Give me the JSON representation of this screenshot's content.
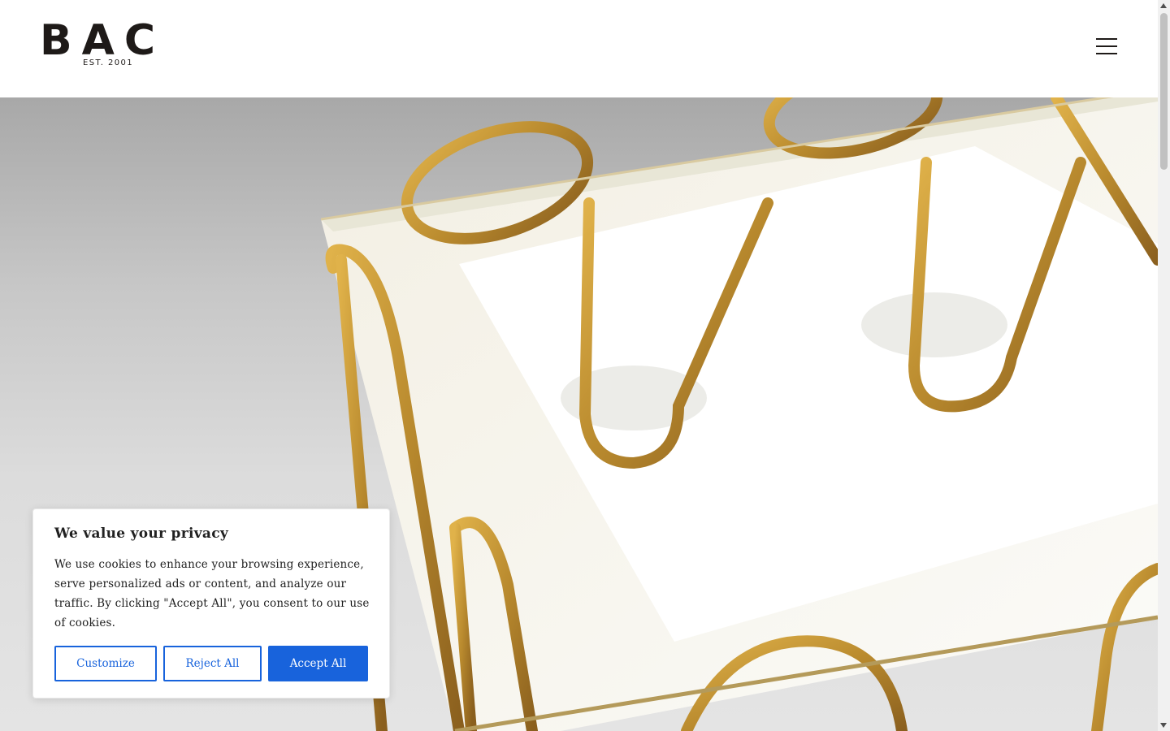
{
  "header": {
    "logo_text": "BAC",
    "logo_subtitle": "EST. 2001",
    "menu_icon": "hamburger-icon"
  },
  "hero": {
    "image_subject": "gilt metal side table with glass top"
  },
  "cookie_banner": {
    "title": "We value your privacy",
    "text": "We use cookies to enhance your browsing experience, serve personalized ads or content, and analyze our traffic. By clicking \"Accept All\", you consent to our use of cookies.",
    "buttons": {
      "customize": "Customize",
      "reject": "Reject All",
      "accept": "Accept All"
    },
    "accent_color": "#1863dc"
  }
}
